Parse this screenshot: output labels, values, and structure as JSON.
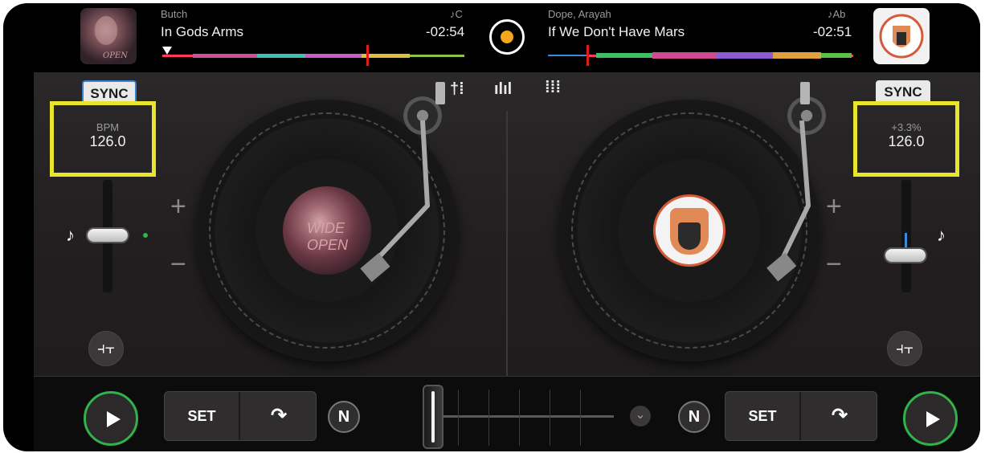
{
  "deck_a": {
    "artist": "Butch",
    "title": "In Gods Arms",
    "key": "♪C",
    "time": "-02:54",
    "sync_label": "SYNC",
    "bpm_label": "BPM",
    "bpm_value": "126.0",
    "artwork_text": "WIDE OPEN"
  },
  "deck_b": {
    "artist": "Dope, Arayah",
    "title": "If We Don't Have Mars",
    "key": "♪Ab",
    "time": "-02:51",
    "sync_label": "SYNC",
    "pitch_label": "+3.3%",
    "bpm_value": "126.0"
  },
  "controls": {
    "plus": "+",
    "minus": "−",
    "set_label": "SET",
    "n_label": "N",
    "loop_icon": "↷",
    "mixer_icon": "⫞⫟",
    "note_icon": "♪"
  },
  "colors": {
    "accent": "#f4a61d",
    "play_ring": "#31b24b",
    "highlight": "#e8e62c",
    "sync_border": "#3a7fd0"
  }
}
